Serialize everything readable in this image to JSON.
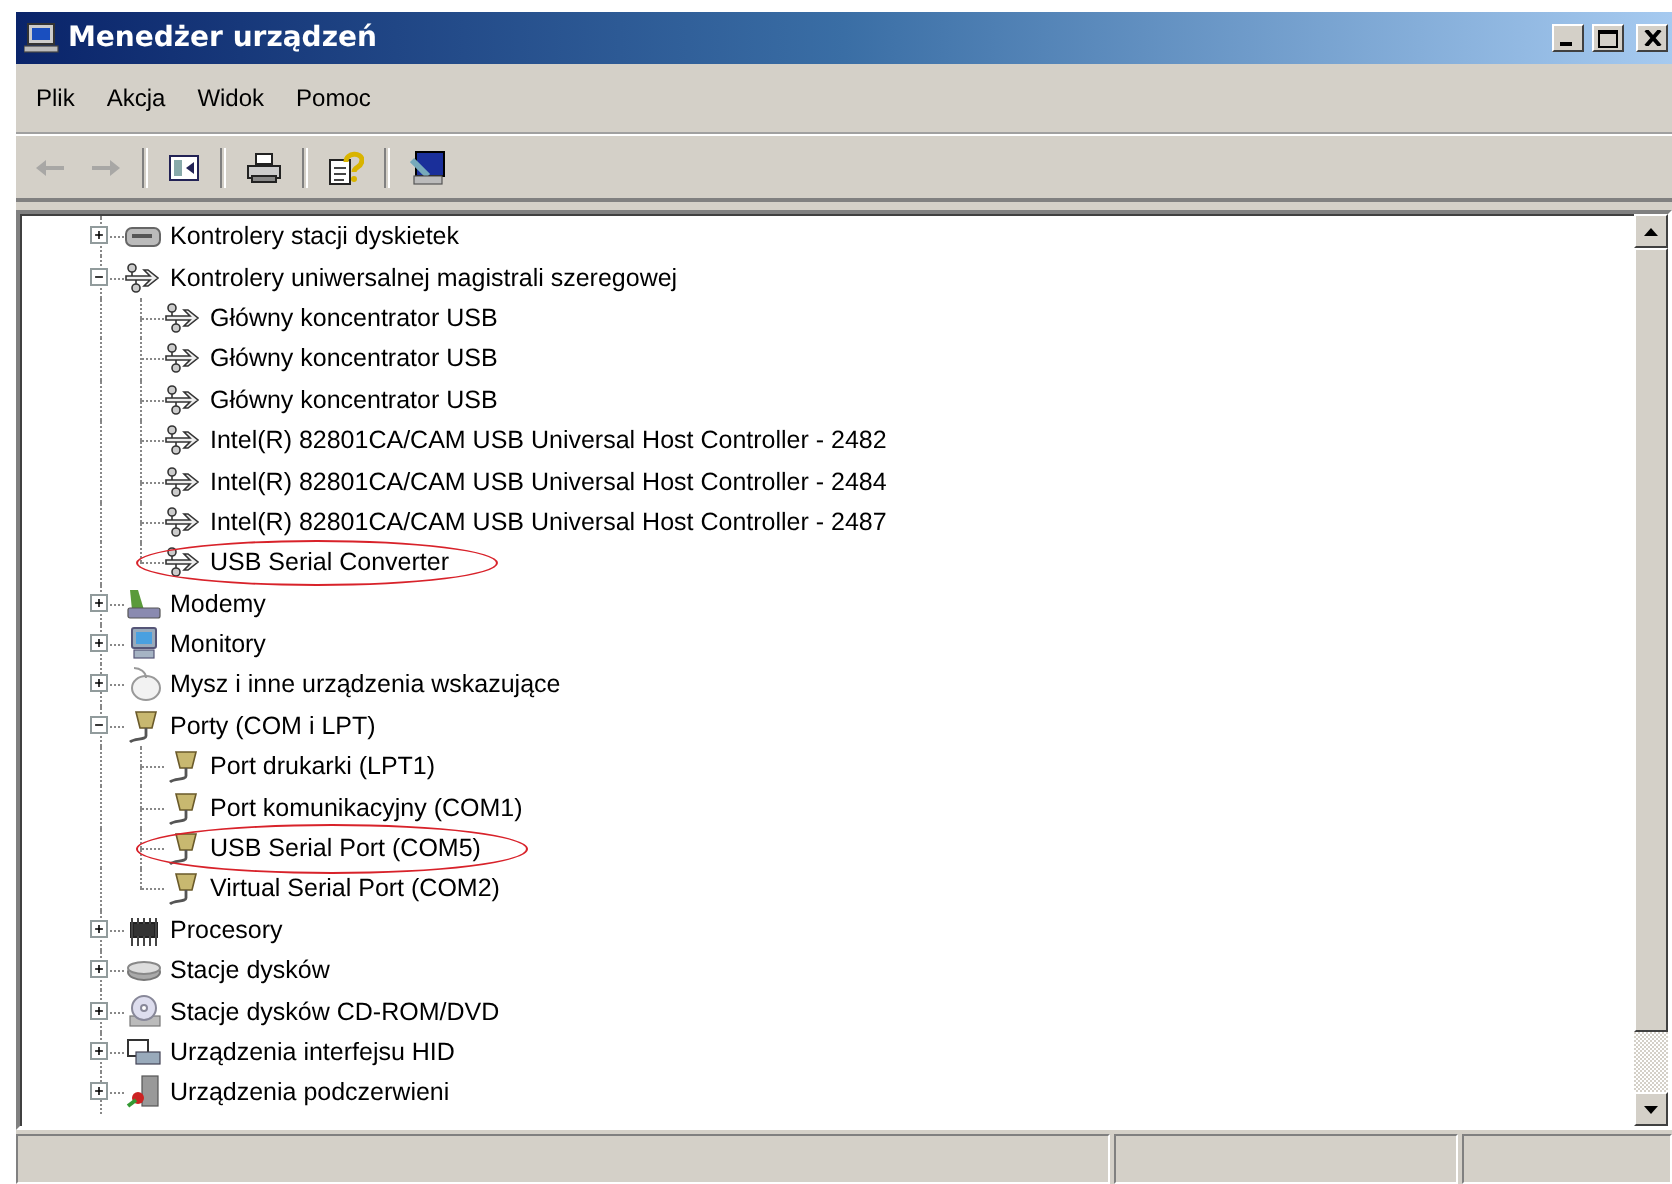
{
  "window": {
    "title": "Menedżer urządzeń"
  },
  "menu": [
    "Plik",
    "Akcja",
    "Widok",
    "Pomoc"
  ],
  "toolbar": [
    {
      "kind": "back",
      "disabled": true
    },
    {
      "kind": "forward",
      "disabled": true
    },
    {
      "kind": "separator"
    },
    {
      "kind": "tree"
    },
    {
      "kind": "separator"
    },
    {
      "kind": "print"
    },
    {
      "kind": "separator"
    },
    {
      "kind": "help"
    },
    {
      "kind": "separator"
    },
    {
      "kind": "scan"
    }
  ],
  "tree": [
    {
      "label": "Kontrolery stacji dyskietek",
      "kind": "floppy",
      "expanded": false,
      "circled": false
    },
    {
      "label": "Kontrolery uniwersalnej magistrali szeregowej",
      "kind": "usb",
      "expanded": true,
      "circled": false,
      "children": [
        {
          "label": "Główny koncentrator USB",
          "kind": "usb",
          "circled": false
        },
        {
          "label": "Główny koncentrator USB",
          "kind": "usb",
          "circled": false
        },
        {
          "label": "Główny koncentrator USB",
          "kind": "usb",
          "circled": false
        },
        {
          "label": "Intel(R) 82801CA/CAM USB Universal Host Controller - 2482",
          "kind": "usb",
          "circled": false
        },
        {
          "label": "Intel(R) 82801CA/CAM USB Universal Host Controller - 2484",
          "kind": "usb",
          "circled": false
        },
        {
          "label": "Intel(R) 82801CA/CAM USB Universal Host Controller - 2487",
          "kind": "usb",
          "circled": false
        },
        {
          "label": "USB Serial Converter",
          "kind": "usb",
          "circled": true
        }
      ]
    },
    {
      "label": "Modemy",
      "kind": "modem",
      "expanded": false,
      "circled": false
    },
    {
      "label": "Monitory",
      "kind": "monitor",
      "expanded": false,
      "circled": false
    },
    {
      "label": "Mysz i inne urządzenia wskazujące",
      "kind": "mouse",
      "expanded": false,
      "circled": false
    },
    {
      "label": "Porty (COM i LPT)",
      "kind": "port",
      "expanded": true,
      "circled": false,
      "children": [
        {
          "label": "Port drukarki (LPT1)",
          "kind": "port",
          "circled": false
        },
        {
          "label": "Port komunikacyjny (COM1)",
          "kind": "port",
          "circled": false
        },
        {
          "label": "USB Serial Port (COM5)",
          "kind": "port",
          "circled": true
        },
        {
          "label": "Virtual Serial Port (COM2)",
          "kind": "port",
          "circled": false
        }
      ]
    },
    {
      "label": "Procesory",
      "kind": "cpu",
      "expanded": false,
      "circled": false
    },
    {
      "label": "Stacje dysków",
      "kind": "disk",
      "expanded": false,
      "circled": false
    },
    {
      "label": "Stacje dysków CD-ROM/DVD",
      "kind": "cdrom",
      "expanded": false,
      "circled": false
    },
    {
      "label": "Urządzenia interfejsu HID",
      "kind": "hid",
      "expanded": false,
      "circled": false
    },
    {
      "label": "Urządzenia podczerwieni",
      "kind": "infrared",
      "expanded": false,
      "circled": false
    }
  ]
}
